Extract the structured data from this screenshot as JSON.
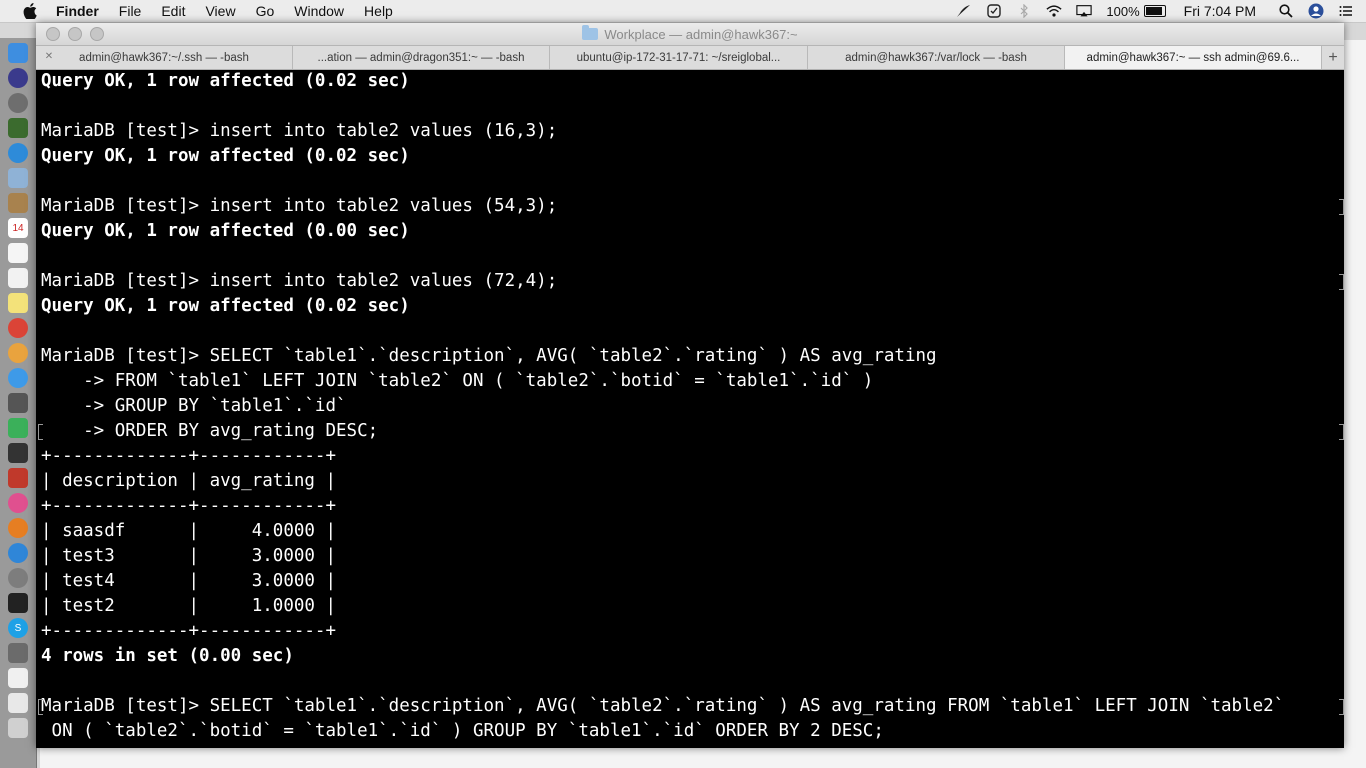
{
  "menubar": {
    "app_name": "Finder",
    "items": [
      "File",
      "Edit",
      "View",
      "Go",
      "Window",
      "Help"
    ],
    "battery_percent": "100%",
    "battery_level": 1.0,
    "clock": "Fri 7:04 PM",
    "icons": [
      "apple-icon",
      "feather-icon",
      "check-circle-icon",
      "bluetooth-icon",
      "wifi-icon",
      "airplay-icon",
      "battery-icon",
      "search-icon",
      "user-icon",
      "list-icon"
    ]
  },
  "window": {
    "title": "Workplace — admin@hawk367:~",
    "tabs": [
      {
        "label": "admin@hawk367:~/.ssh — -bash",
        "active": false
      },
      {
        "label": "...ation — admin@dragon351:~ — -bash",
        "active": false
      },
      {
        "label": "ubuntu@ip-172-31-17-71: ~/sreiglobal...",
        "active": false
      },
      {
        "label": "admin@hawk367:/var/lock — -bash",
        "active": false
      },
      {
        "label": "admin@hawk367:~ — ssh admin@69.6...",
        "active": true
      }
    ],
    "new_tab": "+"
  },
  "terminal": {
    "lines": [
      {
        "text": "Query OK, 1 row affected (0.02 sec)",
        "bold": true
      },
      {
        "text": "",
        "bold": false
      },
      {
        "text": "MariaDB [test]> insert into table2 values (16,3);",
        "bold": false
      },
      {
        "text": "Query OK, 1 row affected (0.02 sec)",
        "bold": true
      },
      {
        "text": "",
        "bold": false
      },
      {
        "text": "MariaDB [test]> insert into table2 values (54,3);",
        "bold": false
      },
      {
        "text": "Query OK, 1 row affected (0.00 sec)",
        "bold": true
      },
      {
        "text": "",
        "bold": false
      },
      {
        "text": "MariaDB [test]> insert into table2 values (72,4);",
        "bold": false
      },
      {
        "text": "Query OK, 1 row affected (0.02 sec)",
        "bold": true
      },
      {
        "text": "",
        "bold": false
      },
      {
        "text": "MariaDB [test]> SELECT `table1`.`description`, AVG( `table2`.`rating` ) AS avg_rating",
        "bold": false
      },
      {
        "text": "    -> FROM `table1` LEFT JOIN `table2` ON ( `table2`.`botid` = `table1`.`id` )",
        "bold": false
      },
      {
        "text": "    -> GROUP BY `table1`.`id`",
        "bold": false
      },
      {
        "text": "    -> ORDER BY avg_rating DESC;",
        "bold": false
      },
      {
        "text": "+-------------+------------+",
        "bold": false
      },
      {
        "text": "| description | avg_rating |",
        "bold": false
      },
      {
        "text": "+-------------+------------+",
        "bold": false
      },
      {
        "text": "| saasdf      |     4.0000 |",
        "bold": false
      },
      {
        "text": "| test3       |     3.0000 |",
        "bold": false
      },
      {
        "text": "| test4       |     3.0000 |",
        "bold": false
      },
      {
        "text": "| test2       |     1.0000 |",
        "bold": false
      },
      {
        "text": "+-------------+------------+",
        "bold": false
      },
      {
        "text": "4 rows in set (0.00 sec)",
        "bold": true
      },
      {
        "text": "",
        "bold": false
      },
      {
        "text": "MariaDB [test]> SELECT `table1`.`description`, AVG( `table2`.`rating` ) AS avg_rating FROM `table1` LEFT JOIN `table2`",
        "bold": false
      },
      {
        "text": " ON ( `table2`.`botid` = `table1`.`id` ) GROUP BY `table1`.`id` ORDER BY 2 DESC;",
        "bold": false
      }
    ]
  },
  "dock": {
    "icons": [
      "finder-icon",
      "siri-icon",
      "launchpad-icon",
      "mission-control-icon",
      "safari-icon",
      "preview-icon",
      "notes-icon",
      "calendar-icon",
      "reminders-icon",
      "textedit-icon",
      "stickies-icon",
      "chrome-icon",
      "photos-icon",
      "messages-icon",
      "app-icon",
      "skype-icon",
      "facetime-icon",
      "photo-booth-icon",
      "itunes-icon",
      "books-icon",
      "app-store-icon",
      "system-preferences-icon",
      "terminal-icon",
      "skype-icon-2",
      "sublime-icon",
      "document-icon",
      "downloads-icon",
      "trash-icon"
    ]
  }
}
